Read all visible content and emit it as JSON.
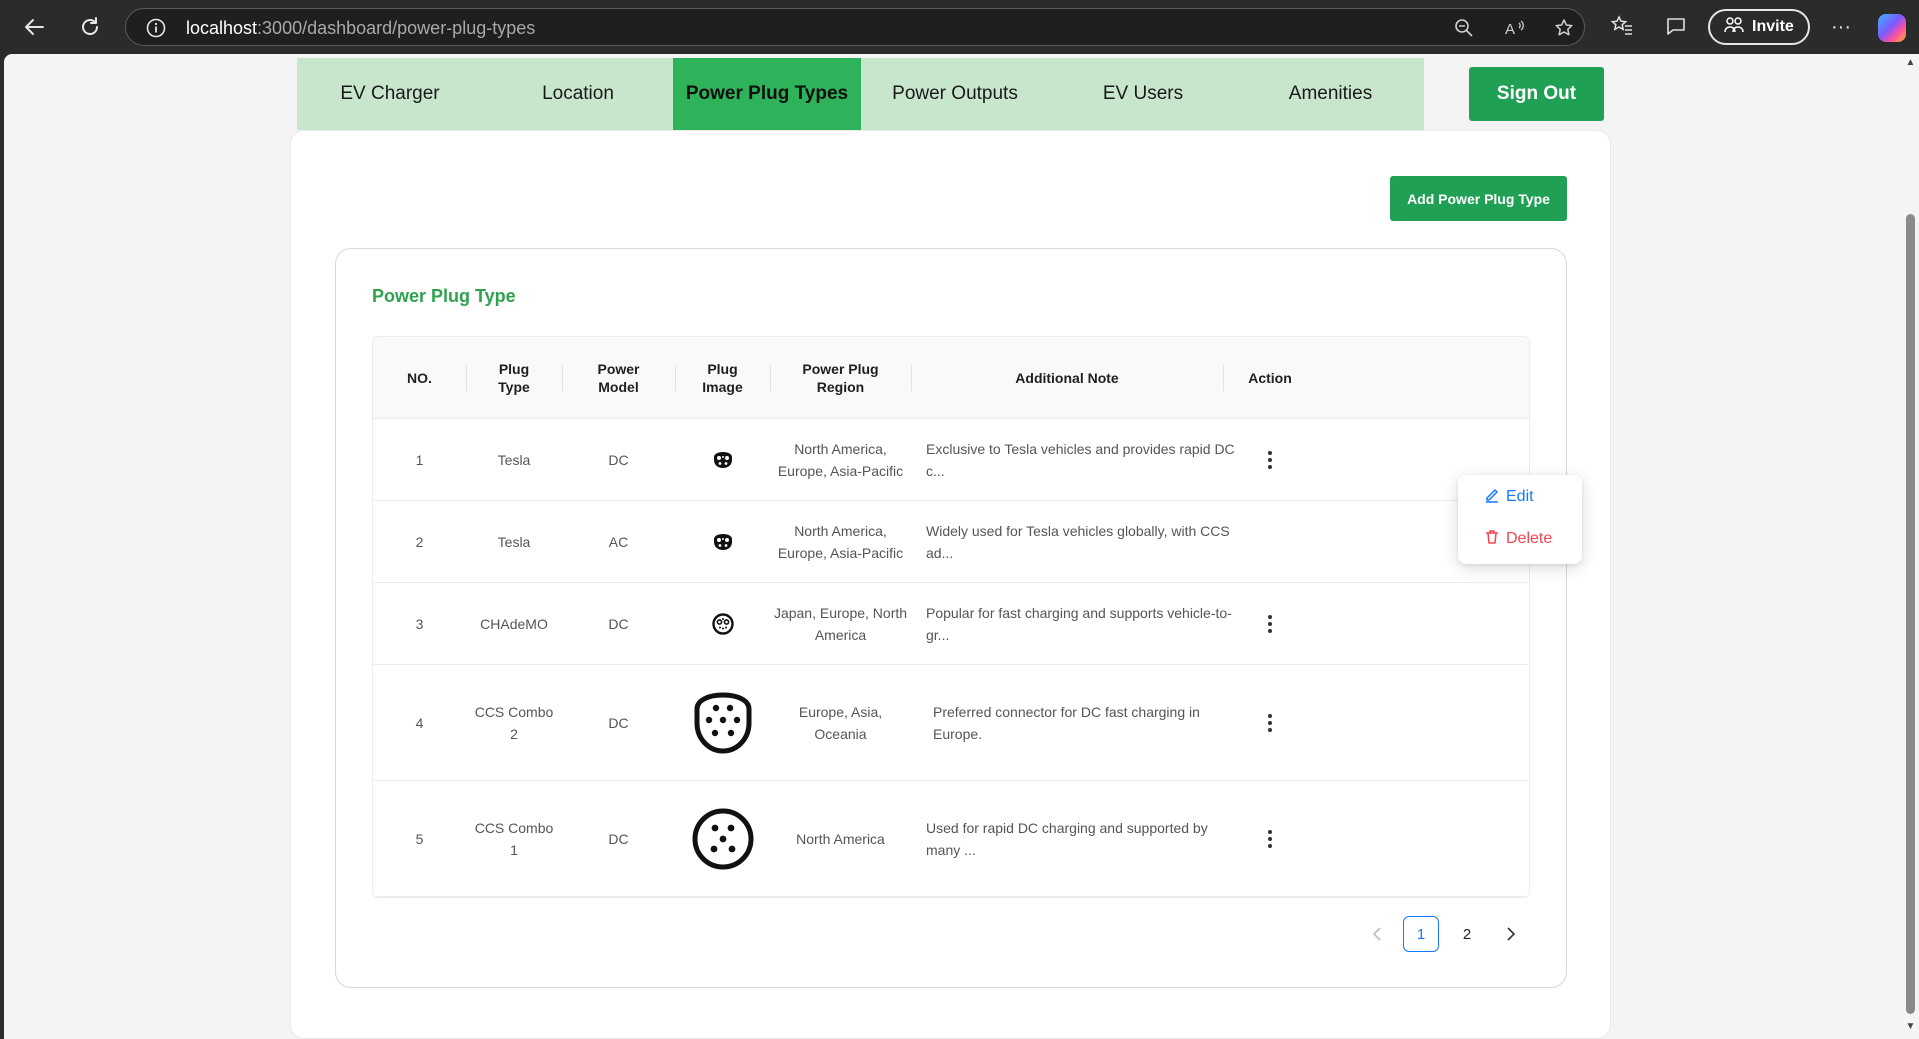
{
  "browser": {
    "url_host": "localhost",
    "url_path": ":3000/dashboard/power-plug-types",
    "invite_label": "Invite"
  },
  "nav": {
    "tabs": [
      {
        "label": "EV Charger",
        "active": false
      },
      {
        "label": "Location",
        "active": false
      },
      {
        "label": "Power Plug Types",
        "active": true
      },
      {
        "label": "Power Outputs",
        "active": false
      },
      {
        "label": "EV Users",
        "active": false
      },
      {
        "label": "Amenities",
        "active": false
      }
    ],
    "signout_label": "Sign Out"
  },
  "page": {
    "add_button_label": "Add Power Plug Type",
    "card_title": "Power Plug Type"
  },
  "table": {
    "headers": [
      "NO.",
      "Plug\nType",
      "Power\nModel",
      "Plug\nImage",
      "Power Plug\nRegion",
      "Additional Note",
      "Action"
    ],
    "rows": [
      {
        "no": "1",
        "plug_type": "Tesla",
        "power_model": "DC",
        "image": "tesla-plug-icon",
        "region": "North America,\nEurope, Asia-Pacific",
        "note": "Exclusive to Tesla vehicles and provides rapid DC c..."
      },
      {
        "no": "2",
        "plug_type": "Tesla",
        "power_model": "AC",
        "image": "tesla-plug-icon",
        "region": "North America,\nEurope, Asia-Pacific",
        "note": "Widely used for Tesla vehicles globally, with CCS ad..."
      },
      {
        "no": "3",
        "plug_type": "CHAdeMO",
        "power_model": "DC",
        "image": "chademo-plug-icon",
        "region": "Japan, Europe, North\nAmerica",
        "note": "Popular for fast charging and supports vehicle-to-gr..."
      },
      {
        "no": "4",
        "plug_type": "CCS Combo\n2",
        "power_model": "DC",
        "image": "ccs2-plug-icon",
        "region": "Europe, Asia,\nOceania",
        "note": "Preferred connector for DC fast charging in Europe."
      },
      {
        "no": "5",
        "plug_type": "CCS Combo\n1",
        "power_model": "DC",
        "image": "ccs1-plug-icon",
        "region": "North America",
        "note": "Used for rapid DC charging and supported by many ..."
      }
    ]
  },
  "action_menu": {
    "edit_label": "Edit",
    "delete_label": "Delete"
  },
  "pagination": {
    "pages": [
      "1",
      "2"
    ],
    "current": "1"
  },
  "colors": {
    "accent_green": "#1fa055",
    "tab_bg": "#c7e6cc",
    "tab_active": "#2fb35a",
    "title_green": "#2fa24f",
    "edit_blue": "#1677ff",
    "delete_red": "#f5454f"
  }
}
